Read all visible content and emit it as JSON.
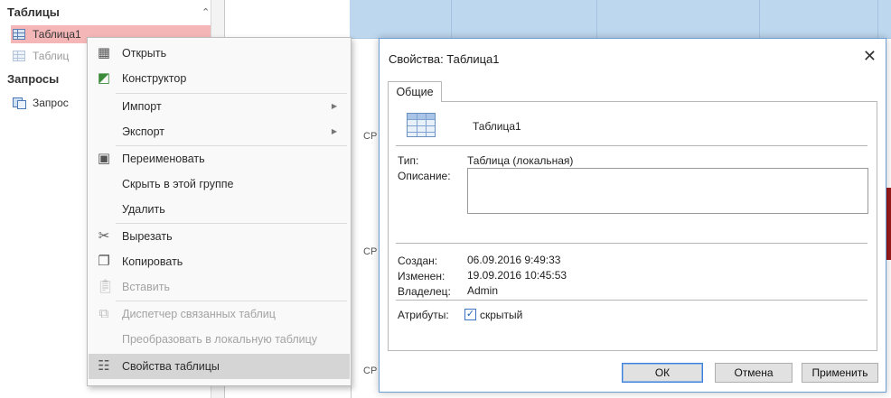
{
  "nav": {
    "tables_header": "Таблицы",
    "collapse_glyph": "≈",
    "items": [
      {
        "label": "Таблица1",
        "icon": "table-icon"
      },
      {
        "label": "Таблиц",
        "icon": "table-icon"
      }
    ],
    "queries_header": "Запросы",
    "query_items": [
      {
        "label": "Запрос",
        "icon": "query-icon"
      }
    ]
  },
  "workspace": {
    "frag1": "СР",
    "frag2": "СР",
    "frag3": "СР"
  },
  "context_menu": {
    "items": [
      {
        "label": "Открыть",
        "icon": "open-icon"
      },
      {
        "label": "Конструктор",
        "icon": "design-view-icon"
      },
      {
        "label": "Импорт"
      },
      {
        "label": "Экспорт"
      },
      {
        "label": "Переименовать",
        "icon": "rename-icon"
      },
      {
        "label": "Скрыть в этой группе"
      },
      {
        "label": "Удалить"
      },
      {
        "label": "Вырезать",
        "icon": "scissors-icon"
      },
      {
        "label": "Копировать",
        "icon": "copy-icon"
      },
      {
        "label": "Вставить",
        "icon": "paste-icon"
      },
      {
        "label": "Диспетчер связанных таблиц",
        "icon": "linked-table-manager-icon"
      },
      {
        "label": "Преобразовать в локальную таблицу"
      },
      {
        "label": "Свойства таблицы",
        "icon": "table-properties-icon"
      }
    ]
  },
  "dialog": {
    "title": "Свойства: Таблица1",
    "close_glyph": "✕",
    "tab": "Общие",
    "object_name": "Таблица1",
    "type_label": "Тип:",
    "type_value": "Таблица (локальная)",
    "description_label": "Описание:",
    "description_value": "",
    "created_label": "Создан:",
    "created_value": "06.09.2016 9:49:33",
    "modified_label": "Изменен:",
    "modified_value": "19.09.2016 10:45:53",
    "owner_label": "Владелец:",
    "owner_value": "Admin",
    "attributes_label": "Атрибуты:",
    "hidden_label": "скрытый",
    "hidden_checked": true,
    "ok": "ОК",
    "cancel": "Отмена",
    "apply": "Применить"
  }
}
